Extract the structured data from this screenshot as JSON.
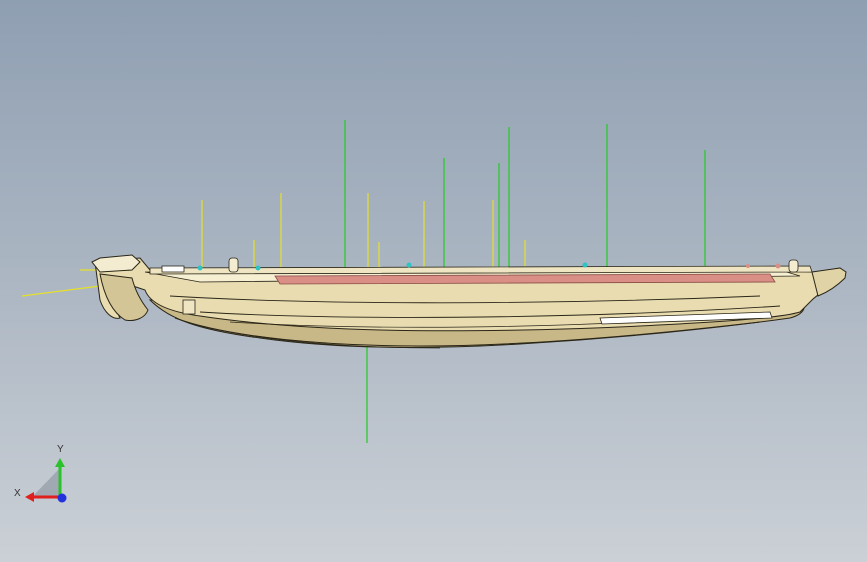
{
  "viewport": {
    "background_top": "#8f9fb2",
    "background_bottom": "#cbd0d6"
  },
  "model": {
    "body_color": "#e8dcb0",
    "shadow_color": "#c9b887",
    "edge_color": "#2a2618",
    "highlight_color": "#f6efd2",
    "rail_color": "#d98e86",
    "green_line_color": "#22cc22",
    "yellow_line_color": "#e6e02a",
    "cyan_marker_color": "#2ec4c4"
  },
  "triad": {
    "x_label": "X",
    "y_label": "Y",
    "x_color": "#e0201e",
    "y_color": "#2ac12a",
    "z_color": "#2233dd"
  }
}
